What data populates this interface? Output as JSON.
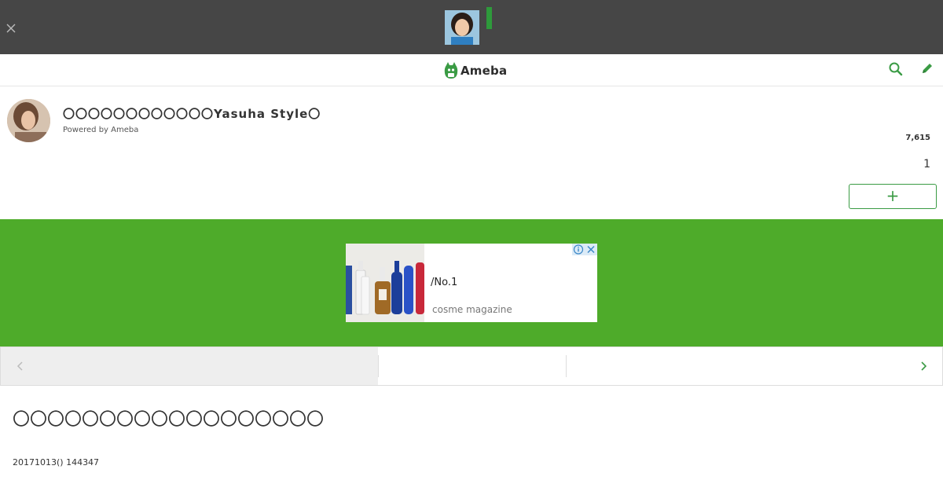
{
  "topbar": {
    "close_icon": "close-icon"
  },
  "header": {
    "logo_text": "Ameba",
    "search_icon": "search-icon",
    "edit_icon": "pencil-icon"
  },
  "blog": {
    "title": "〇〇〇〇〇〇〇〇〇〇〇〇Yasuha Style〇",
    "powered_by": "Powered by Ameba",
    "reader_count": "7,615",
    "like_count": "1",
    "follow_label": "+"
  },
  "ad": {
    "headline": "/No.1",
    "source": "cosme magazine",
    "info_icon": "info-icon",
    "close_icon": "close-icon"
  },
  "pager": {
    "prev_icon": "chevron-left-icon",
    "next_icon": "chevron-right-icon"
  },
  "article": {
    "title": "〇〇〇〇〇〇〇〇〇〇〇〇〇〇〇〇〇〇",
    "date": "20171013() 144347"
  },
  "colors": {
    "topbar": "#464646",
    "brand_green": "#3a9b44",
    "ad_background": "#4eab2a"
  }
}
